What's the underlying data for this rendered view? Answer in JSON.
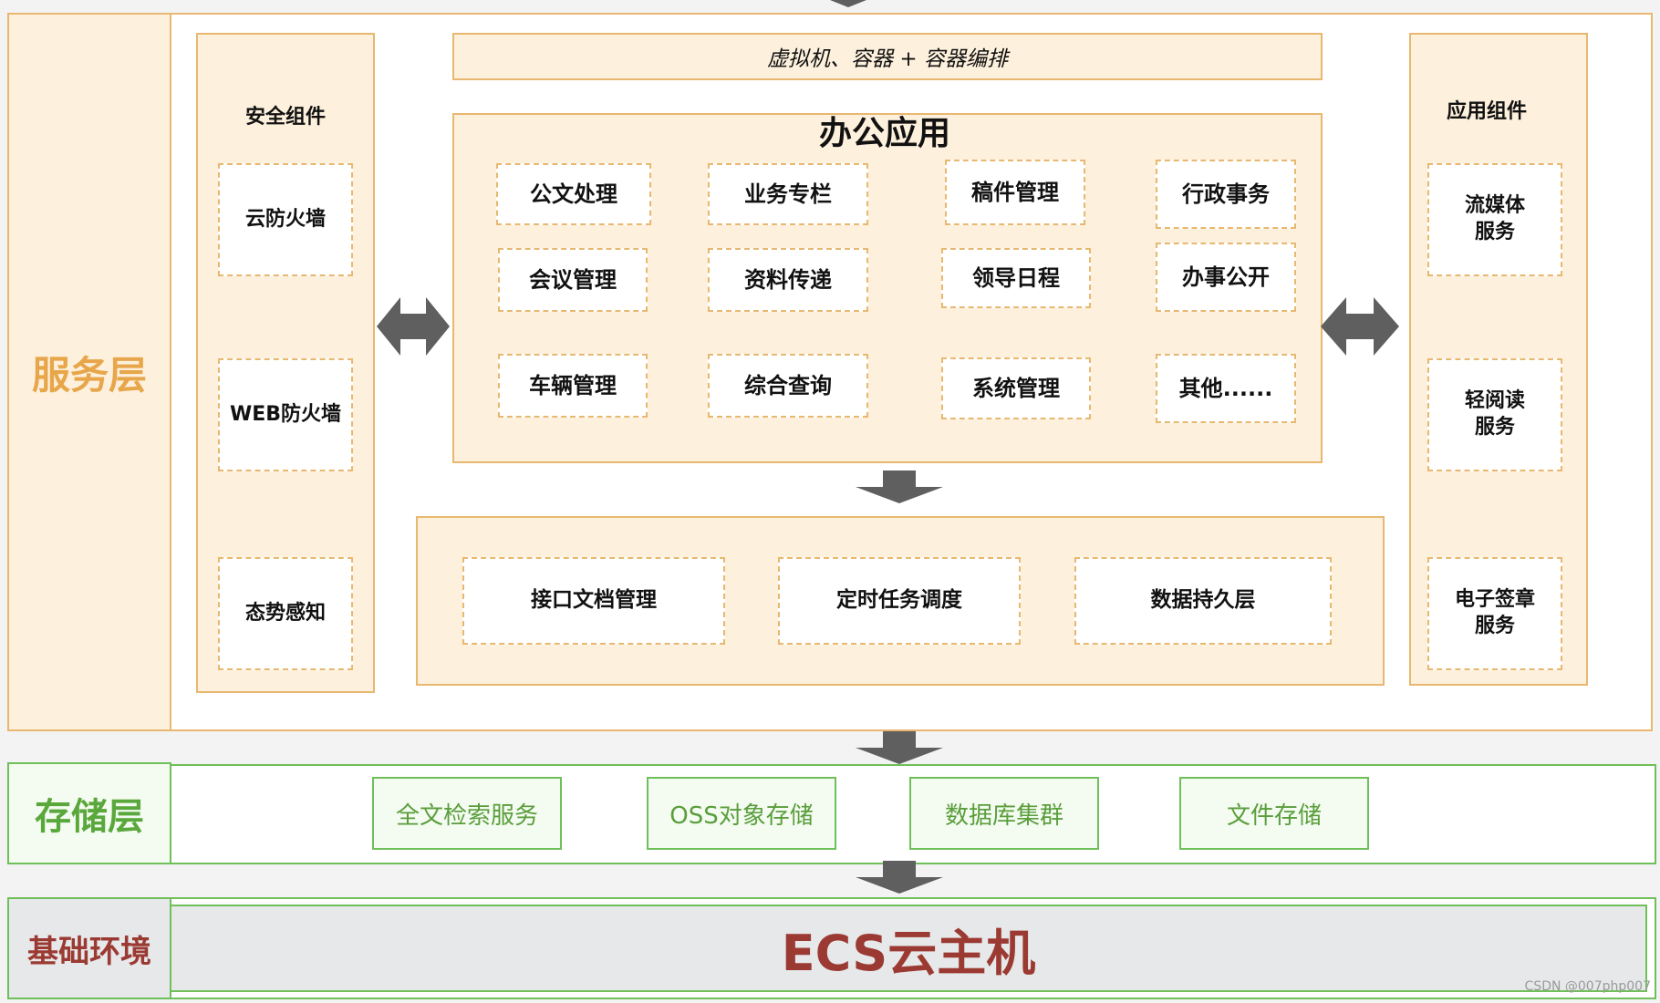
{
  "service_layer": {
    "label": "服务层",
    "top_banner": "虚拟机、容器 + 容器编排",
    "security": {
      "title": "安全组件",
      "items": [
        "云防火墙",
        "WEB防火墙",
        "态势感知"
      ]
    },
    "office": {
      "title": "办公应用",
      "rows": [
        [
          "公文处理",
          "业务专栏",
          "稿件管理",
          "行政事务"
        ],
        [
          "会议管理",
          "资料传递",
          "领导日程",
          "办事公开"
        ],
        [
          "车辆管理",
          "综合查询",
          "系统管理",
          "其他......"
        ]
      ]
    },
    "support": {
      "items": [
        "接口文档管理",
        "定时任务调度",
        "数据持久层"
      ]
    },
    "app_components": {
      "title": "应用组件",
      "items": [
        "流媒体服务",
        "轻阅读服务",
        "电子签章服务"
      ]
    }
  },
  "storage_layer": {
    "label": "存储层",
    "items": [
      "全文检索服务",
      "OSS对象存储",
      "数据库集群",
      "文件存储"
    ]
  },
  "base_layer": {
    "label": "基础环境",
    "main": "ECS云主机"
  },
  "watermark": "CSDN @007php007",
  "colors": {
    "service": "#e8a64a",
    "storage": "#5aa83c",
    "base": "#9b3a32",
    "arrow": "#5f5f5f"
  }
}
